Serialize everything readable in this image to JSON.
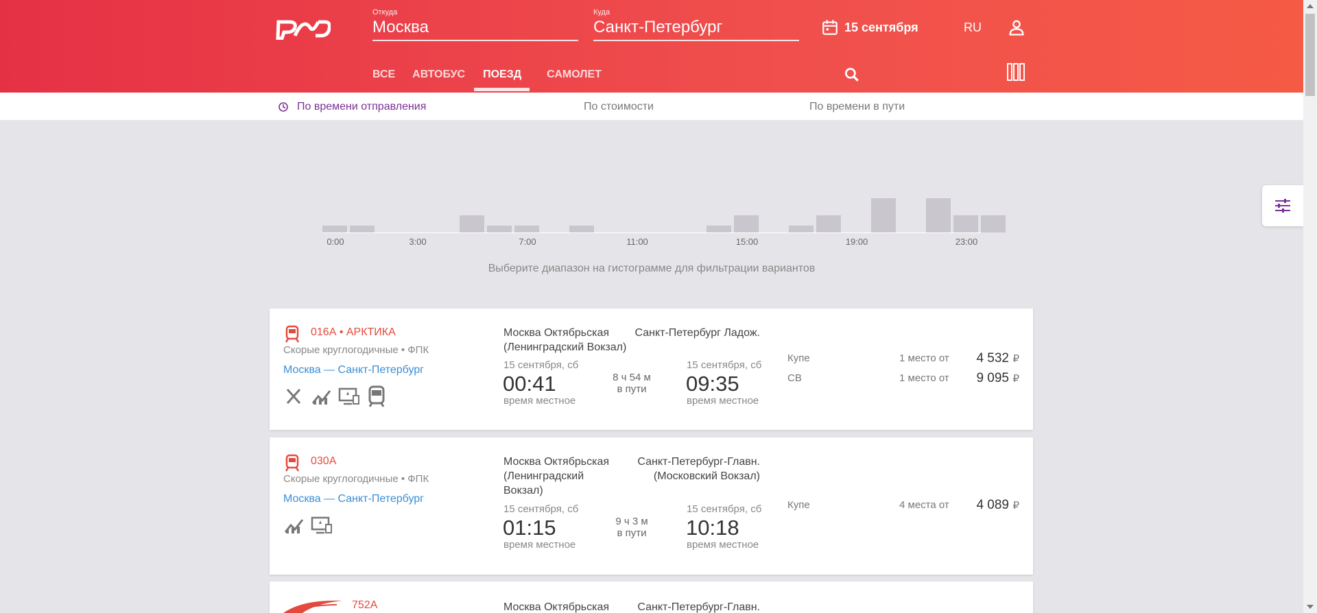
{
  "header": {
    "from_label": "Откуда",
    "from_value": "Москва",
    "to_label": "Куда",
    "to_value": "Санкт-Петербург",
    "date": "15 сентября",
    "lang": "RU",
    "tabs": [
      {
        "label": "ВСЕ",
        "active": false
      },
      {
        "label": "АВТОБУС",
        "active": false
      },
      {
        "label": "ПОЕЗД",
        "active": true
      },
      {
        "label": "САМОЛЕТ",
        "active": false
      }
    ]
  },
  "sort": {
    "by_departure": "По времени отправления",
    "by_price": "По стоимости",
    "by_duration": "По времени в пути"
  },
  "histogram": {
    "ticks": [
      "0:00",
      "3:00",
      "7:00",
      "11:00",
      "15:00",
      "19:00",
      "23:00"
    ],
    "bars": [
      0.2,
      0.2,
      0,
      0,
      0,
      0.5,
      0.2,
      0.2,
      0,
      0.2,
      0,
      0,
      0,
      0,
      0.2,
      0.5,
      0,
      0.2,
      0.5,
      0,
      1.0,
      0,
      1.0,
      0.5,
      0.5
    ],
    "hint": "Выберите диапазон на гистограмме для фильтрации вариантов"
  },
  "colors": {
    "accent": "#e63145",
    "link": "#3a8ed4",
    "train_number": "#e44a3c",
    "active_sort": "#7b2f96"
  },
  "trains": [
    {
      "number": "016А • АРКТИКА",
      "category": "Скорые круглогодичные • ФПК",
      "route": "Москва — Санкт-Петербург",
      "amenities": [
        "restaurant-icon",
        "chart-icon",
        "media-icon",
        "train-car-icon"
      ],
      "dep_station": "Москва Октябрьская (Ленинградский Вокзал)",
      "arr_station": "Санкт-Петербург Ладож.",
      "dep_date": "15 сентября, сб",
      "dep_time": "00:41",
      "arr_date": "15 сентября, сб",
      "arr_time": "09:35",
      "local_label": "время местное",
      "duration": "8 ч 54 м",
      "duration_label": "в пути",
      "fares": [
        {
          "class": "Купе",
          "seats": "1 место от",
          "price": "4 532"
        },
        {
          "class": "СВ",
          "seats": "1 место от",
          "price": "9 095"
        }
      ]
    },
    {
      "number": "030А",
      "category": "Скорые круглогодичные • ФПК",
      "route": "Москва — Санкт-Петербург",
      "amenities": [
        "chart-icon",
        "media-icon"
      ],
      "dep_station": "Москва Октябрьская (Ленинградский Вокзал)",
      "arr_station": "Санкт-Петербург-Главн. (Московский Вокзал)",
      "dep_date": "15 сентября, сб",
      "dep_time": "01:15",
      "arr_date": "15 сентября, сб",
      "arr_time": "10:18",
      "local_label": "время местное",
      "duration": "9 ч 3 м",
      "duration_label": "в пути",
      "fares": [
        {
          "class": "Купе",
          "seats": "4 места от",
          "price": "4 089"
        }
      ]
    },
    {
      "number": "752А",
      "dep_station": "Москва Октябрьская",
      "arr_station": "Санкт-Петербург-Главн."
    }
  ],
  "currency": "₽"
}
